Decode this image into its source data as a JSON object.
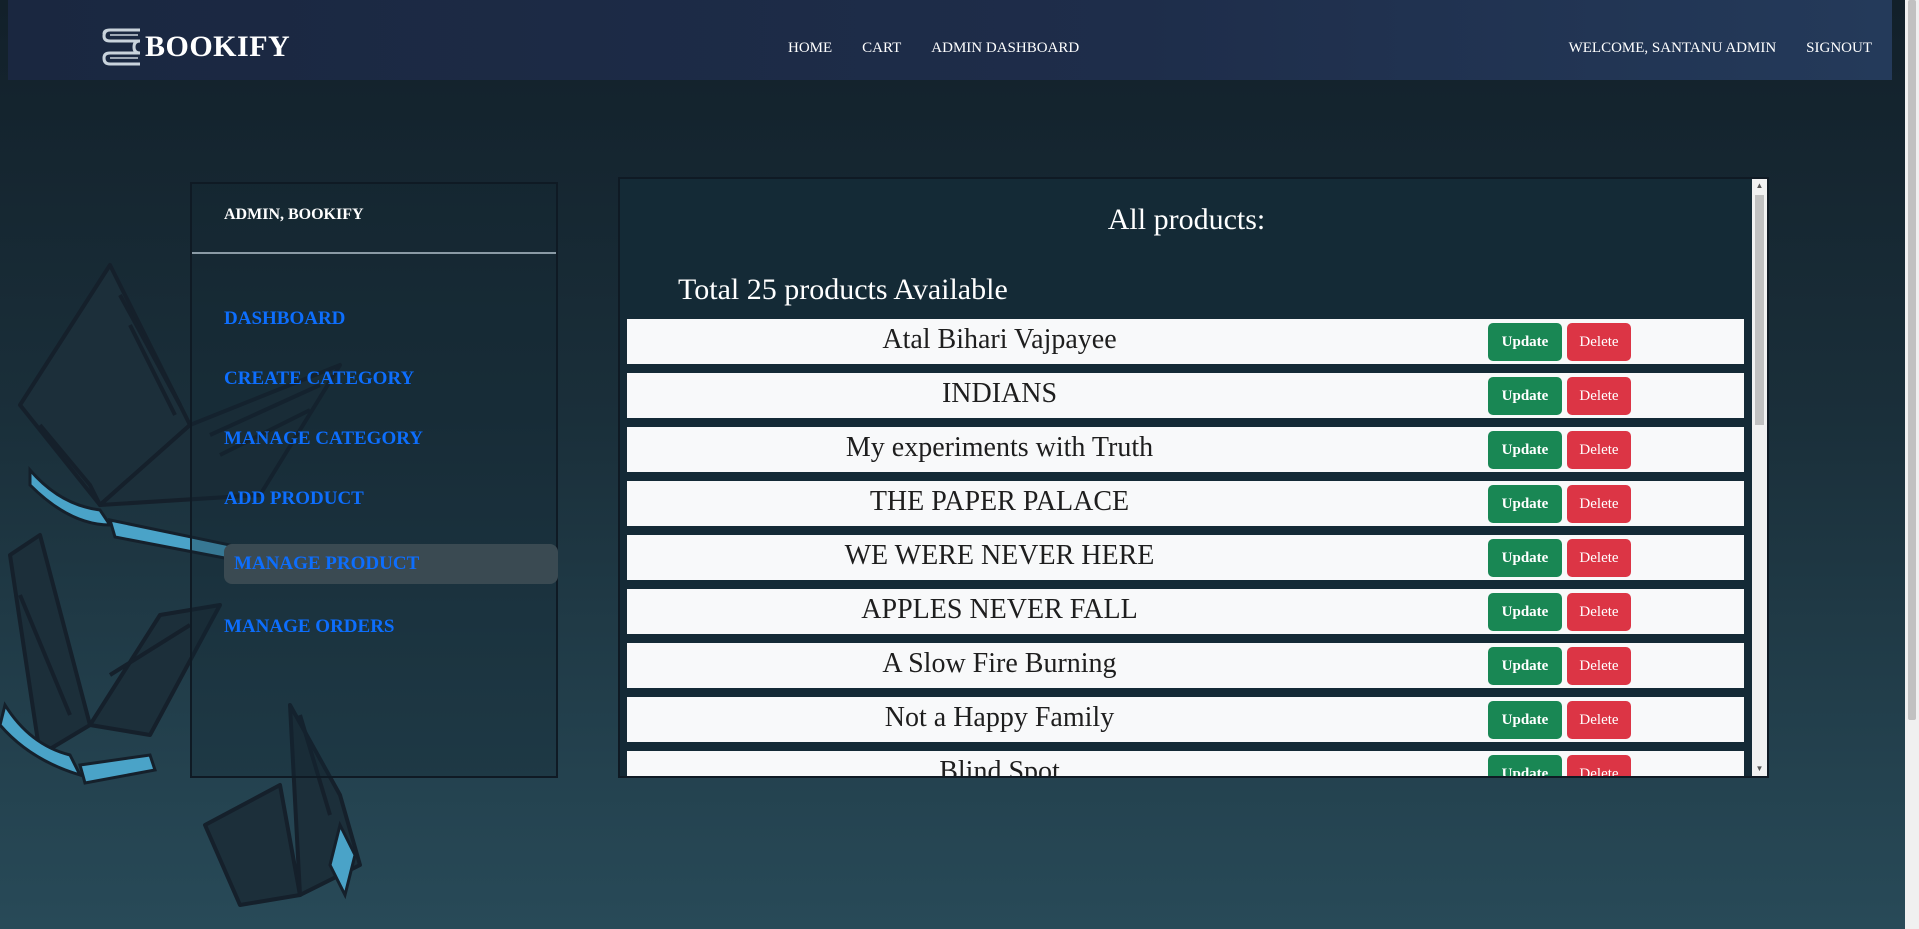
{
  "navbar": {
    "brand": "BOOKIFY",
    "center_links": [
      "HOME",
      "CART",
      "ADMIN DASHBOARD"
    ],
    "welcome": "WELCOME, SANTANU ADMIN",
    "signout": "SIGNOUT"
  },
  "sidebar": {
    "header": "ADMIN, BOOKIFY",
    "items": [
      {
        "label": "DASHBOARD"
      },
      {
        "label": "CREATE CATEGORY"
      },
      {
        "label": "MANAGE CATEGORY"
      },
      {
        "label": "ADD PRODUCT"
      },
      {
        "label": "MANAGE PRODUCT",
        "active": true
      },
      {
        "label": "MANAGE ORDERS"
      }
    ]
  },
  "main": {
    "title": "All products:",
    "subtitle": "Total 25 products Available",
    "update_label": "Update",
    "delete_label": "Delete",
    "products": [
      "Atal Bihari Vajpayee",
      "INDIANS",
      "My experiments with Truth",
      "THE PAPER PALACE",
      "WE WERE NEVER HERE",
      "APPLES NEVER FALL",
      "A Slow Fire Burning",
      "Not a Happy Family",
      "Blind Spot"
    ]
  },
  "colors": {
    "link_blue": "#0d6efd",
    "update_green": "#198754",
    "delete_red": "#dc3545",
    "book_accent": "#4aa3c8"
  }
}
